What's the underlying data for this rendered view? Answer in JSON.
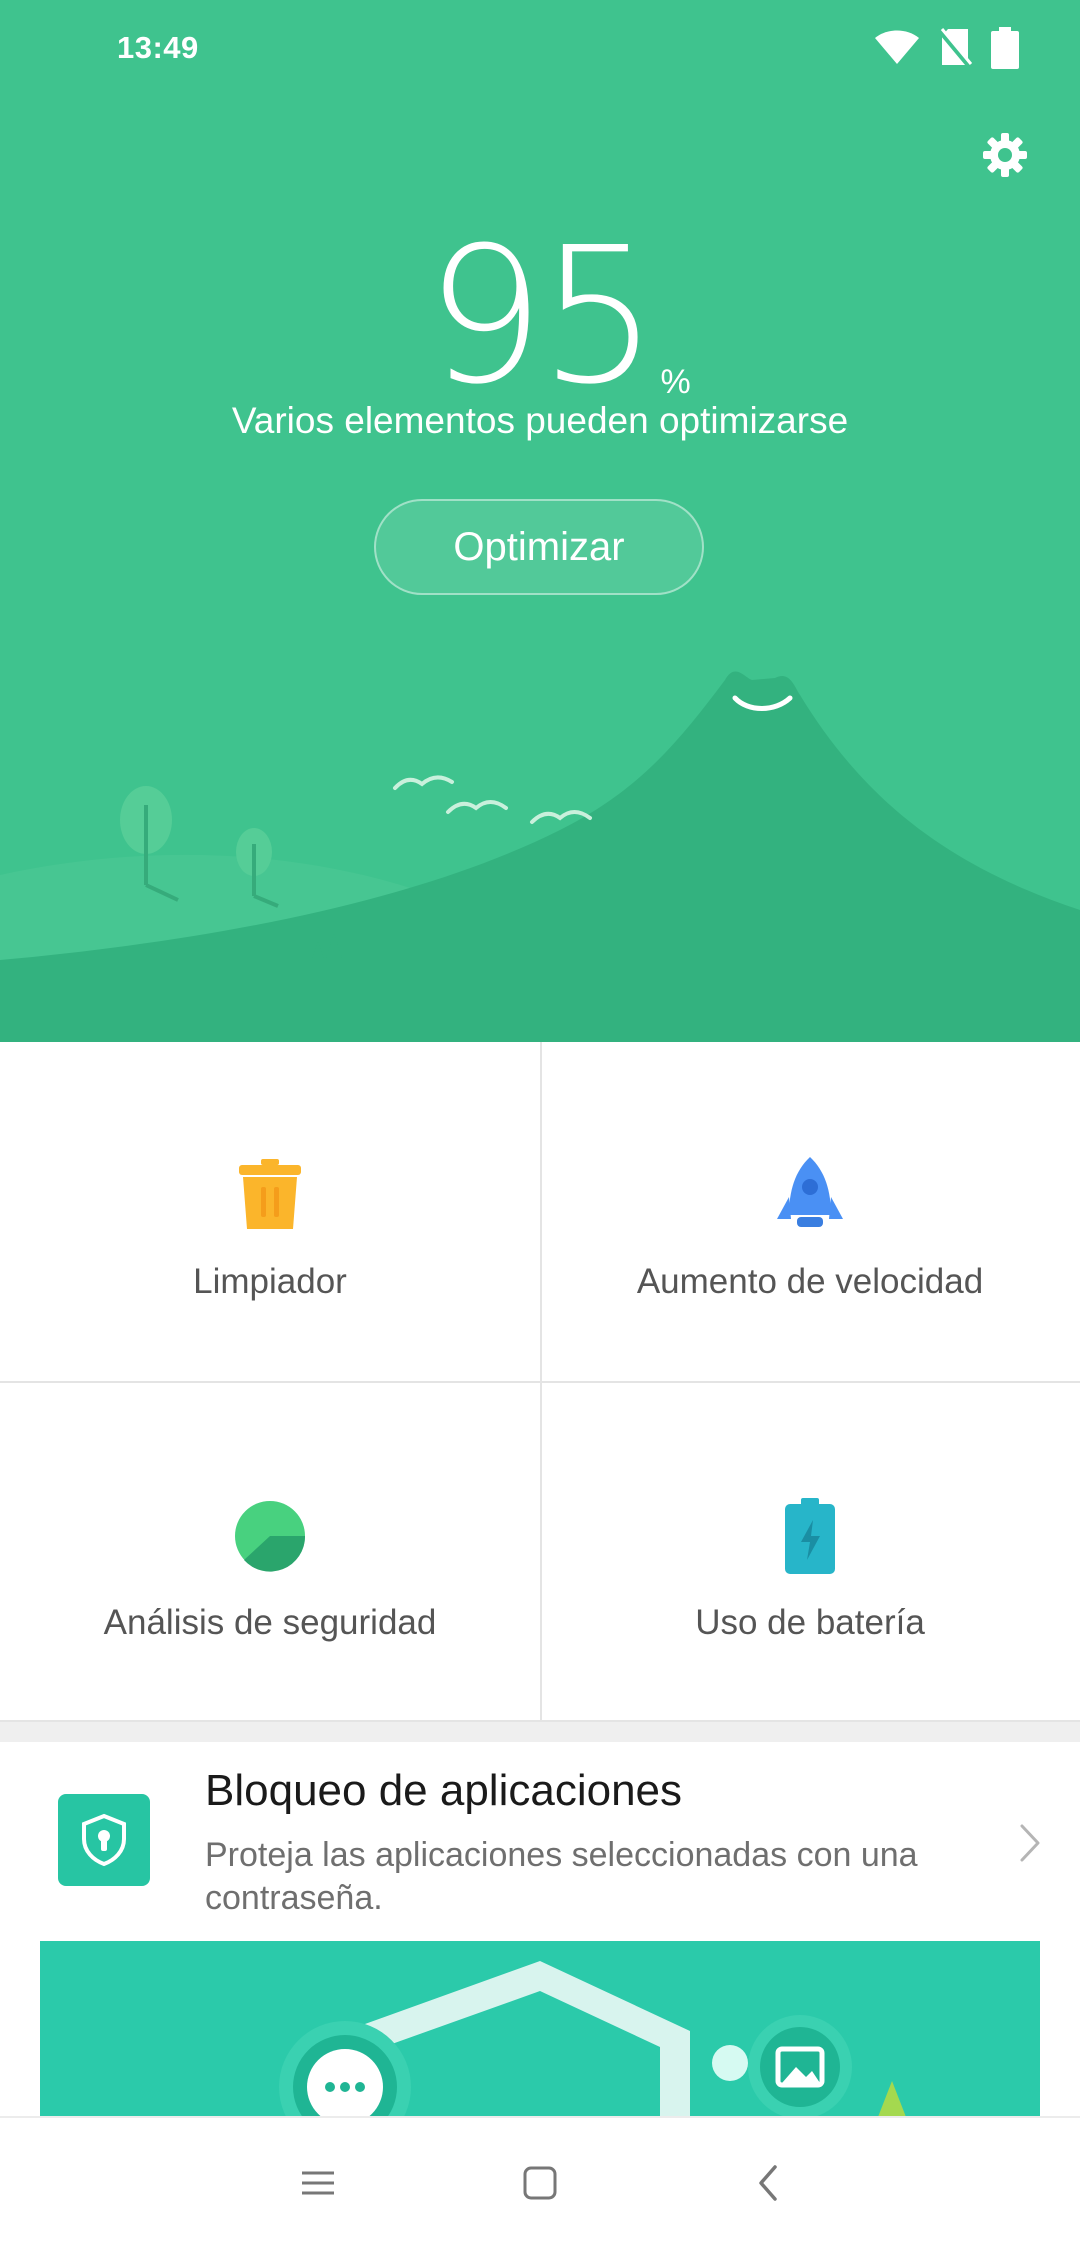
{
  "status_bar": {
    "time": "13:49",
    "icons": [
      "wifi-icon",
      "no-sim-icon",
      "battery-icon"
    ]
  },
  "header": {
    "settings_icon": "gear-icon"
  },
  "score": {
    "value": "95",
    "unit": "%",
    "status_text": "Varios elementos pueden optimizarse",
    "action_label": "Optimizar"
  },
  "tools": [
    {
      "label": "Limpiador",
      "icon": "trash-icon",
      "color": "#fbb52b"
    },
    {
      "label": "Aumento de velocidad",
      "icon": "rocket-icon",
      "color": "#4a90f4"
    },
    {
      "label": "Análisis de seguridad",
      "icon": "security-scan-icon",
      "color": "#3cc576"
    },
    {
      "label": "Uso de batería",
      "icon": "battery-charge-icon",
      "color": "#27b5c9"
    }
  ],
  "app_lock": {
    "title": "Bloqueo de aplicaciones",
    "description": "Proteja las aplicaciones seleccionadas con una contraseña.",
    "icon": "shield-lock-icon"
  },
  "colors": {
    "hero": "#3fc38e",
    "card_icon": "#27c5a3",
    "banner": "#2bcaaa"
  },
  "navigation": {
    "items": [
      "menu-icon",
      "home-icon",
      "back-icon"
    ]
  }
}
